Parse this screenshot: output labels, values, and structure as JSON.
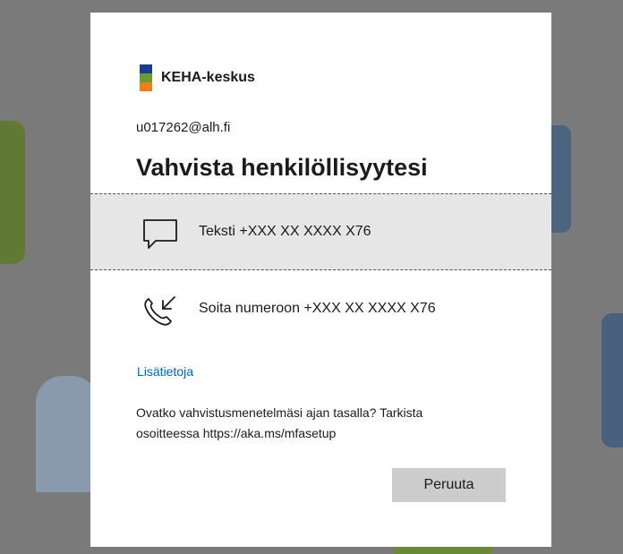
{
  "brand": {
    "name": "KEHA-keskus"
  },
  "account": {
    "email": "u017262@alh.fi"
  },
  "title": "Vahvista henkilöllisyytesi",
  "options": [
    {
      "label": "Teksti +XXX XX XXXX X76",
      "icon": "message-icon",
      "selected": true
    },
    {
      "label": "Soita numeroon +XXX XX XXXX X76",
      "icon": "phone-incoming-icon",
      "selected": false
    }
  ],
  "more_info_link": "Lisätietoja",
  "notice": {
    "line1": "Ovatko vahvistusmenetelmäsi ajan tasalla? Tarkista",
    "line2": "osoitteessa https://aka.ms/mfasetup"
  },
  "buttons": {
    "cancel": "Peruuta"
  },
  "colors": {
    "link": "#0067b8",
    "selected_bg": "#e6e6e6",
    "button_bg": "#cccccc"
  }
}
